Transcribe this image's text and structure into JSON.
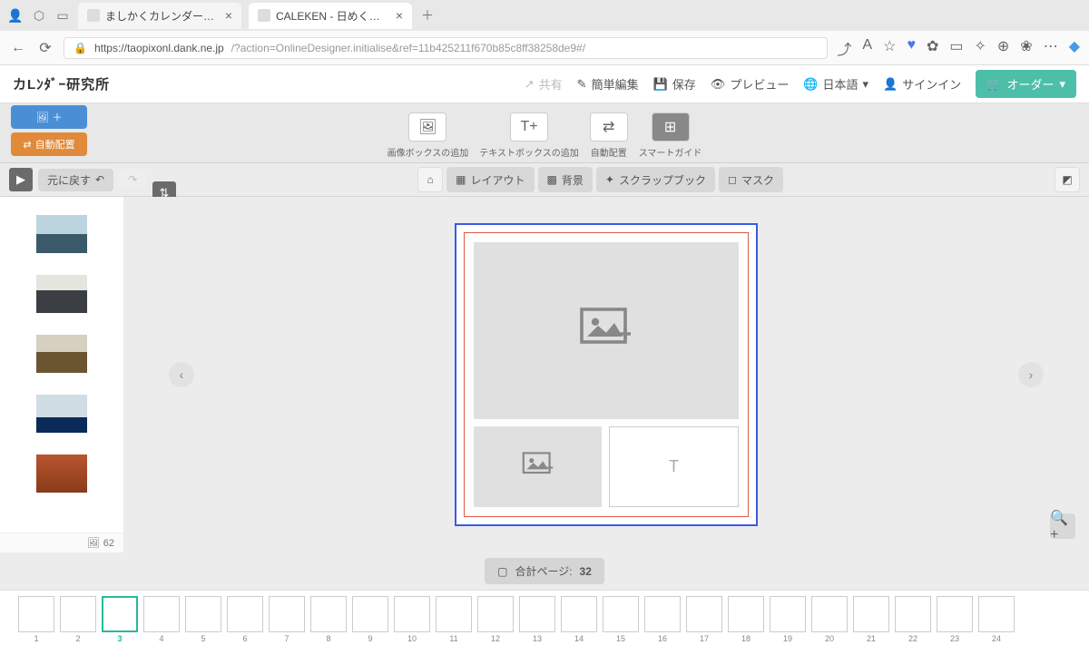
{
  "tabs": [
    {
      "title": "ましかくカレンダー（日めくり） - "
    },
    {
      "title": "CALEKEN - 日めくりカレンダー#"
    }
  ],
  "url": {
    "host": "https://taopixonl.dank.ne.jp",
    "path": "/?action=OnlineDesigner.initialise&ref=11b425211f670b85c8ff38258de9#/"
  },
  "logo": "カLﾝﾀﾞｰ研究所",
  "header": {
    "share": "共有",
    "easy_edit": "簡単編集",
    "save": "保存",
    "preview": "プレビュー",
    "language": "日本語",
    "signin": "サインイン",
    "order": "オーダー"
  },
  "side": {
    "add_image": "＋",
    "auto_layout": "自動配置"
  },
  "toolbar": {
    "add_image_box": "画像ボックスの追加",
    "add_text_box": "テキストボックスの追加",
    "auto_layout": "自動配置",
    "smart_guide": "スマートガイド"
  },
  "sub": {
    "undo": "元に戻す",
    "home": "⌂",
    "layout": "レイアウト",
    "background": "背景",
    "scrapbook": "スクラップブック",
    "mask": "マスク"
  },
  "text_placeholder": "T",
  "image_count": "62",
  "page_count": {
    "label": "合計ページ:",
    "value": "32"
  },
  "current_page": 3,
  "total_thumbs": 24
}
